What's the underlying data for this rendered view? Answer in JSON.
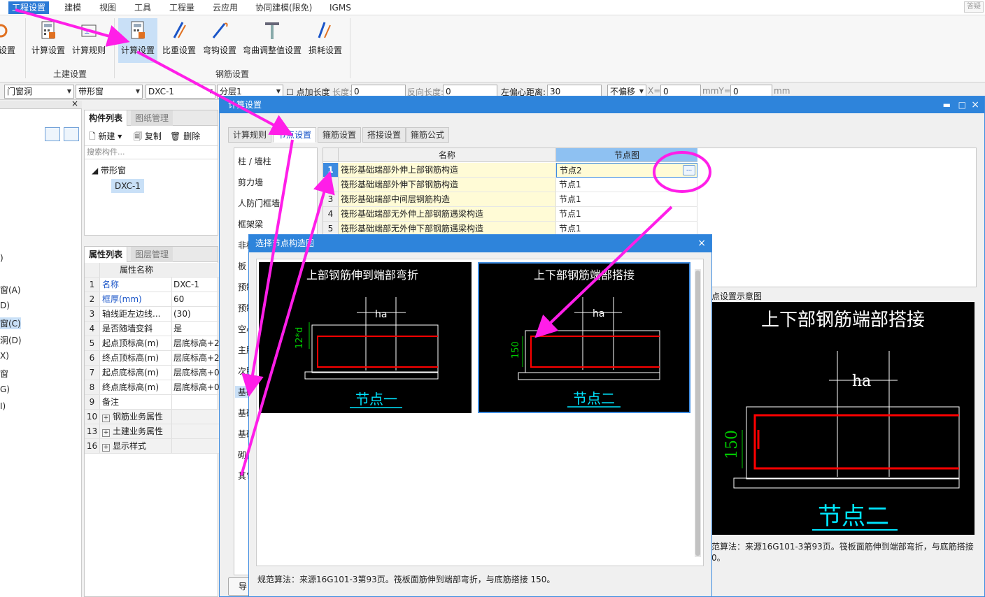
{
  "menu": {
    "items": [
      "工程设置",
      "建模",
      "视图",
      "工具",
      "工程量",
      "云应用",
      "协同建模(限免)",
      "IGMS"
    ],
    "active_index": 0,
    "right_label": "答疑"
  },
  "ribbon": {
    "buttons": [
      "设置",
      "计算设置",
      "计算规则",
      "计算设置",
      "比重设置",
      "弯钩设置",
      "弯曲调整值设置",
      "损耗设置"
    ],
    "groups": [
      "土建设置",
      "钢筋设置"
    ]
  },
  "propbar": {
    "type": "门窗洞",
    "subtype": "带形窗",
    "name": "DXC-1",
    "layer": "分层1",
    "add_length_label": "点加长度",
    "length_label": "长度:",
    "length_value": "0",
    "reverse_length_label": "反向长度:",
    "reverse_length_value": "0",
    "left_offset_label": "左偏心距离:",
    "left_offset_value": "30",
    "offset_mode": "不偏移",
    "x_label": "X=",
    "x_value": "0",
    "mm_y_label": "mmY=",
    "y_value": "0",
    "mm_label": "mm"
  },
  "left_panel": {
    "items": [
      ")",
      "窗(A)",
      "D)",
      "窗(C)",
      "洞(D)",
      "X)",
      "窗",
      "G)",
      "I)"
    ]
  },
  "component_list": {
    "tabs": [
      "构件列表",
      "图纸管理"
    ],
    "new_label": "新建",
    "copy_label": "复制",
    "delete_label": "删除",
    "search_placeholder": "搜索构件...",
    "tree_parent": "带形窗",
    "tree_child": "DXC-1"
  },
  "property_list": {
    "tabs": [
      "属性列表",
      "图层管理"
    ],
    "header": "属性名称",
    "rows": [
      {
        "n": "1",
        "k": "名称",
        "v": "DXC-1",
        "blue": true
      },
      {
        "n": "2",
        "k": "框厚(mm)",
        "v": "60",
        "blue": true
      },
      {
        "n": "3",
        "k": "轴线距左边线...",
        "v": "(30)"
      },
      {
        "n": "4",
        "k": "是否随墙变斜",
        "v": "是"
      },
      {
        "n": "5",
        "k": "起点顶标高(m)",
        "v": "层底标高+2"
      },
      {
        "n": "6",
        "k": "终点顶标高(m)",
        "v": "层底标高+2"
      },
      {
        "n": "7",
        "k": "起点底标高(m)",
        "v": "层底标高+0"
      },
      {
        "n": "8",
        "k": "终点底标高(m)",
        "v": "层底标高+0"
      },
      {
        "n": "9",
        "k": "备注",
        "v": ""
      },
      {
        "n": "10",
        "k": "钢筋业务属性",
        "v": "",
        "group": true
      },
      {
        "n": "13",
        "k": "土建业务属性",
        "v": "",
        "group": true
      },
      {
        "n": "16",
        "k": "显示样式",
        "v": "",
        "group": true
      }
    ]
  },
  "dialog": {
    "title": "计算设置",
    "tabs": [
      "计算规则",
      "节点设置",
      "箍筋设置",
      "搭接设置",
      "箍筋公式"
    ],
    "categories": [
      "柱 / 墙柱",
      "剪力墙",
      "人防门框墙",
      "框架梁",
      "非框",
      "板 /",
      "预制",
      "预制",
      "空心",
      "主肋",
      "次肋",
      "基础",
      "基础",
      "基础",
      "砌体",
      "其它"
    ],
    "grid_headers": [
      "名称",
      "节点图"
    ],
    "rows": [
      {
        "n": "1",
        "name": "筏形基础端部外伸上部钢筋构造",
        "value": "节点2"
      },
      {
        "n": "2",
        "name": "筏形基础端部外伸下部钢筋构造",
        "value": "节点1"
      },
      {
        "n": "3",
        "name": "筏形基础端部中间层钢筋构造",
        "value": "节点1"
      },
      {
        "n": "4",
        "name": "筏形基础端部无外伸上部钢筋遇梁构造",
        "value": "节点1"
      },
      {
        "n": "5",
        "name": "筏形基础端部无外伸下部钢筋遇梁构造",
        "value": "节点1"
      }
    ],
    "ellipsis": "...",
    "preview_label": "点设置示意图",
    "preview_title": "上下部钢筋端部搭接",
    "preview_caption": "节点二",
    "preview_ha": "ha",
    "preview_dim": "150",
    "preview_desc_line1": "范算法：来源16G101-3第93页。筏板面筋伸到端部弯折，与底筋搭接",
    "preview_desc_line2": "0。",
    "export_label": "导"
  },
  "sub_dialog": {
    "title": "选择节点构造图",
    "nodes": [
      {
        "title": "上部钢筋伸到端部弯折",
        "ha": "ha",
        "dim": "12*d",
        "caption": "节点一"
      },
      {
        "title": "上下部钢筋端部搭接",
        "ha": "ha",
        "dim": "150",
        "caption": "节点二"
      }
    ],
    "description": "规范算法：来源16G101-3第93页。筏板面筋伸到端部弯折，与底筋搭接 150。"
  },
  "colors": {
    "accent": "#2e84db",
    "annotation": "#ff1ee8",
    "rebar": "#ff0000",
    "dim_green": "#00c800",
    "caption_cyan": "#00e5ff"
  }
}
